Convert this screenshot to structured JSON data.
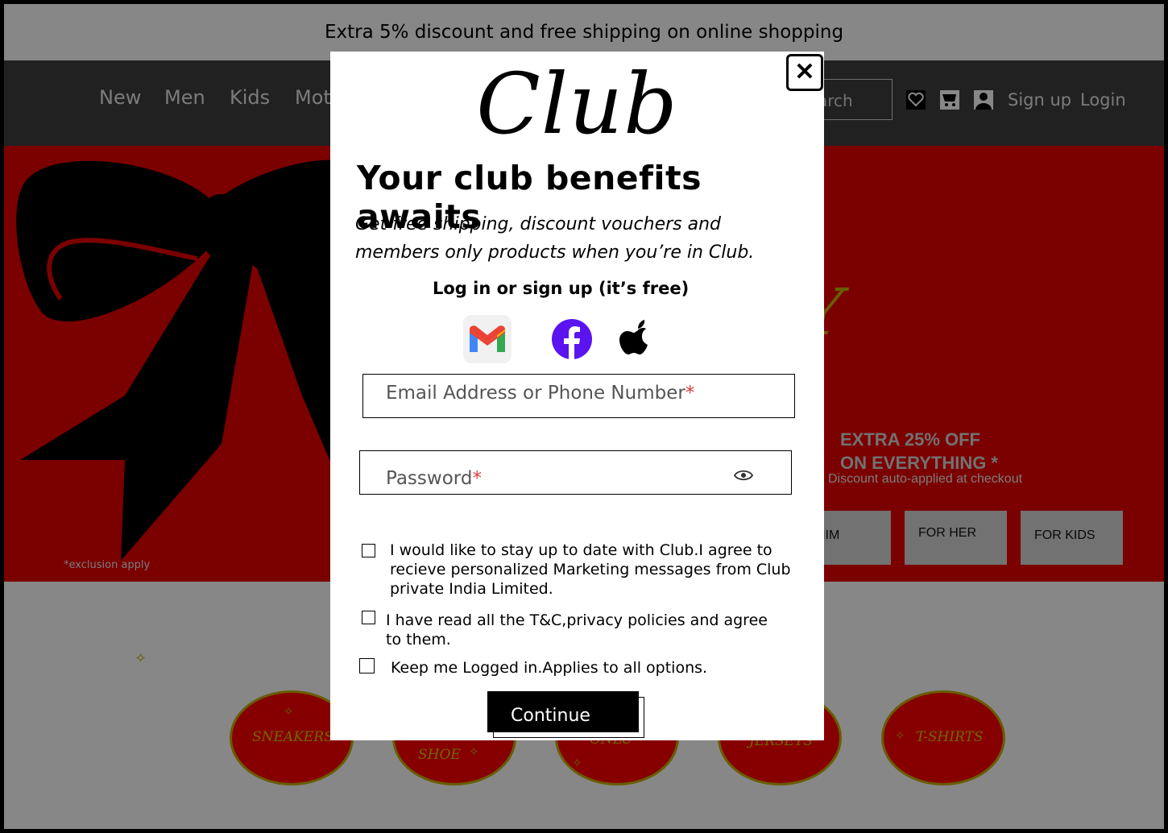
{
  "promo": {
    "text": "Extra 5% discount and free shipping on online shopping"
  },
  "nav": {
    "links": [
      "New",
      "Men",
      "Kids",
      "Mot"
    ],
    "search_placeholder": "arch",
    "icons": [
      "heart-icon",
      "cart-icon",
      "user-icon"
    ],
    "signup": "Sign up",
    "login": "Login"
  },
  "hero": {
    "offer_line1": "EXTRA 25% OFF",
    "offer_line2": "ON EVERYTHING *",
    "offer_sub": "Discount auto-applied at checkout",
    "yellow_text": "Y",
    "buttons": [
      "R HIM",
      "FOR HER",
      "FOR KIDS"
    ],
    "exclusion": "*exclusion apply",
    "bow_color": "#000000",
    "bg_color": "#e80000"
  },
  "categories": {
    "items": [
      "SNEAKERS",
      "SHOE",
      "ONLU",
      "JERSEYS",
      "T-SHIRTS"
    ]
  },
  "modal": {
    "brand": "Club",
    "headline": "Your club benefits awaits",
    "tagline": "Get free shipping, discount vouchers and members only products when you’re in Club.",
    "login_hint": "Log in or sign up (it’s free)",
    "social": [
      "gmail-icon",
      "facebook-icon",
      "apple-icon"
    ],
    "email_label": "Email Address or Phone Number",
    "password_label": "Password",
    "required_mark": "*",
    "checks": [
      "I would like to stay up to date with Club.I agree to recieve personalized Marketing messages from Club private India Limited.",
      "I have read all the T&C,privacy policies and agree to them.",
      "Keep me Logged in.Applies to all options."
    ],
    "continue": "Continue",
    "close_symbol": "✕"
  }
}
